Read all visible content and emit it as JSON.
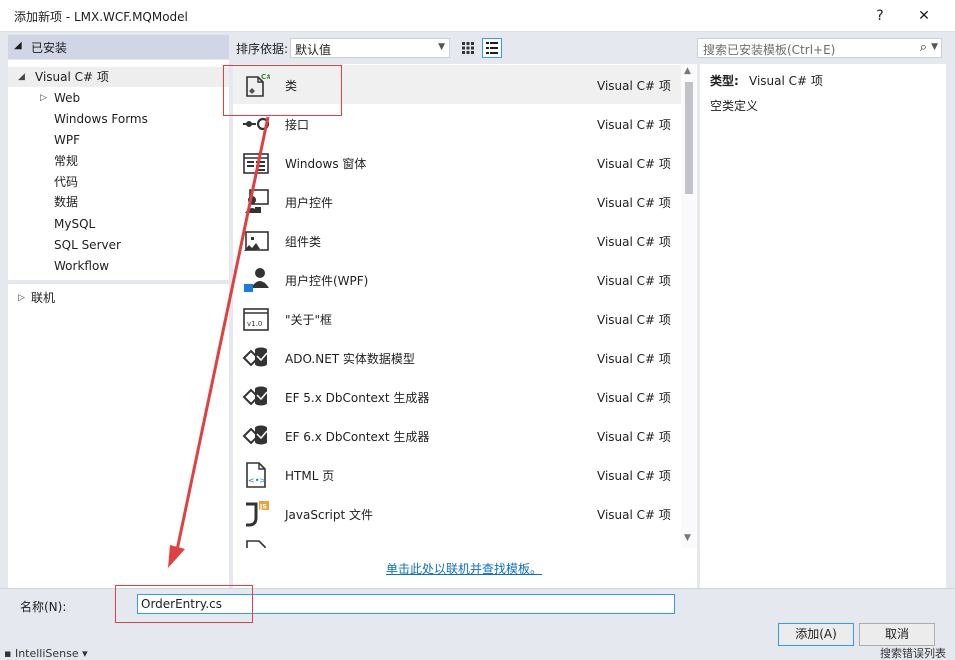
{
  "window": {
    "title": "添加新项 - LMX.WCF.MQModel",
    "help_label": "?",
    "close_label": "✕"
  },
  "left_panel": {
    "installed_label": "已安装",
    "tree": [
      {
        "label": "Visual C# 项",
        "expanded": true
      },
      {
        "label": "Web",
        "collapsed": true
      },
      {
        "label": "Windows Forms"
      },
      {
        "label": "WPF"
      },
      {
        "label": "常规"
      },
      {
        "label": "代码"
      },
      {
        "label": "数据"
      },
      {
        "label": "MySQL"
      },
      {
        "label": "SQL Server"
      },
      {
        "label": "Workflow"
      }
    ],
    "online_label": "联机"
  },
  "toolbar": {
    "sort_label": "排序依据:",
    "sort_value": "默认值",
    "search_placeholder": "搜索已安装模板(Ctrl+E)"
  },
  "templates": [
    {
      "name": "类",
      "category": "Visual C# 项",
      "icon": "class-icon",
      "selected": true
    },
    {
      "name": "接口",
      "category": "Visual C# 项",
      "icon": "interface-icon"
    },
    {
      "name": "Windows 窗体",
      "category": "Visual C# 项",
      "icon": "form-icon"
    },
    {
      "name": "用户控件",
      "category": "Visual C# 项",
      "icon": "user-control-icon"
    },
    {
      "name": "组件类",
      "category": "Visual C# 项",
      "icon": "component-icon"
    },
    {
      "name": "用户控件(WPF)",
      "category": "Visual C# 项",
      "icon": "wpf-user-control-icon"
    },
    {
      "name": "\"关于\"框",
      "category": "Visual C# 项",
      "icon": "about-box-icon"
    },
    {
      "name": "ADO.NET 实体数据模型",
      "category": "Visual C# 项",
      "icon": "entity-model-icon"
    },
    {
      "name": "EF 5.x DbContext 生成器",
      "category": "Visual C# 项",
      "icon": "dbcontext-icon"
    },
    {
      "name": "EF 6.x DbContext 生成器",
      "category": "Visual C# 项",
      "icon": "dbcontext-icon"
    },
    {
      "name": "HTML 页",
      "category": "Visual C# 项",
      "icon": "html-page-icon"
    },
    {
      "name": "JavaScript 文件",
      "category": "Visual C# 项",
      "icon": "javascript-file-icon"
    }
  ],
  "online_link": "单击此处以联机并查找模板。",
  "detail": {
    "type_label": "类型:",
    "type_value": "Visual C# 项",
    "description": "空类定义"
  },
  "name_field": {
    "label": "名称(N):",
    "value": "OrderEntry.cs"
  },
  "buttons": {
    "add": "添加(A)",
    "cancel": "取消"
  },
  "behind": {
    "left": "IntelliSense",
    "right": "搜索错误列表"
  },
  "colors": {
    "accent": "#3399ff",
    "annotation": "#e04040",
    "link": "#0e70c0"
  }
}
